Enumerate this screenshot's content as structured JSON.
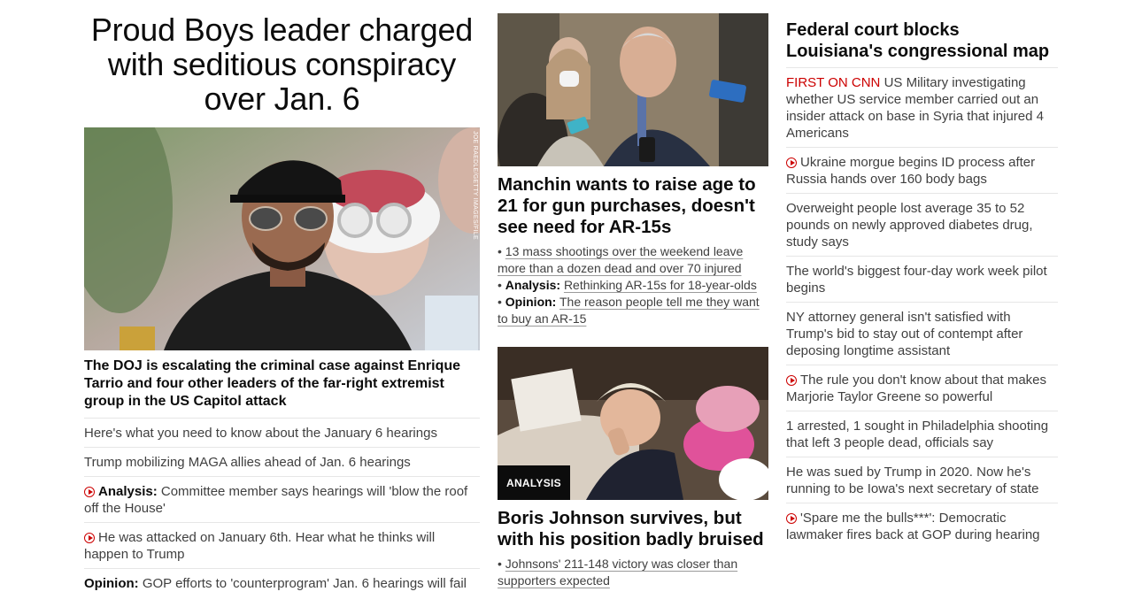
{
  "lead": {
    "headline": "Proud Boys leader charged with seditious conspiracy over Jan. 6",
    "photo_credit": "JOE RAEDLE/GETTY IMAGES/FILE",
    "subheadline": "The DOJ is escalating the criminal case against Enrique Tarrio and four other leaders of the far-right extremist group in the US Capitol attack",
    "related": [
      {
        "kicker": "",
        "text": "Here's what you need to know about the January 6 hearings",
        "video": false
      },
      {
        "kicker": "",
        "text": "Trump mobilizing MAGA allies ahead of Jan. 6 hearings",
        "video": false
      },
      {
        "kicker": "Analysis:",
        "text": "Committee member says hearings will 'blow the roof off the House'",
        "video": true
      },
      {
        "kicker": "",
        "text": "He was attacked on January 6th. Hear what he thinks will happen to Trump",
        "video": true
      },
      {
        "kicker": "Opinion:",
        "text": "GOP efforts to 'counterprogram' Jan. 6 hearings will fail",
        "video": false
      }
    ]
  },
  "middle": {
    "story1": {
      "headline": "Manchin wants to raise age to 21 for gun purchases, doesn't see need for AR-15s",
      "bullets": [
        {
          "kicker": "",
          "text": "13 mass shootings over the weekend leave more than a dozen dead and over 70 injured"
        },
        {
          "kicker": "Analysis:",
          "text": "Rethinking AR-15s for 18-year-olds"
        },
        {
          "kicker": "Opinion:",
          "text": "The reason people tell me they want to buy an AR-15"
        }
      ]
    },
    "story2": {
      "badge": "ANALYSIS",
      "headline": "Boris Johnson survives, but with his position badly bruised",
      "bullets": [
        {
          "kicker": "",
          "text": "Johnsons' 211-148 victory was closer than supporters expected"
        }
      ]
    }
  },
  "right": {
    "headline": "Federal court blocks Louisiana's congressional map",
    "items": [
      {
        "prefix": "FIRST ON CNN",
        "text": "US Military investigating whether US service member carried out an insider attack on base in Syria that injured 4 Americans",
        "video": false
      },
      {
        "prefix": "",
        "text": "Ukraine morgue begins ID process after Russia hands over 160 body bags",
        "video": true
      },
      {
        "prefix": "",
        "text": "Overweight people lost average 35 to 52 pounds on newly approved diabetes drug, study says",
        "video": false
      },
      {
        "prefix": "",
        "text": "The world's biggest four-day work week pilot begins",
        "video": false
      },
      {
        "prefix": "",
        "text": "NY attorney general isn't satisfied with Trump's bid to stay out of contempt after deposing longtime assistant",
        "video": false
      },
      {
        "prefix": "",
        "text": "The rule you don't know about that makes Marjorie Taylor Greene so powerful",
        "video": true
      },
      {
        "prefix": "",
        "text": "1 arrested, 1 sought in Philadelphia shooting that left 3 people dead, officials say",
        "video": false
      },
      {
        "prefix": "",
        "text": "He was sued by Trump in 2020. Now he's running to be Iowa's next secretary of state",
        "video": false
      },
      {
        "prefix": "",
        "text": "'Spare me the bulls***': Democratic lawmaker fires back at GOP during hearing",
        "video": true
      }
    ]
  }
}
